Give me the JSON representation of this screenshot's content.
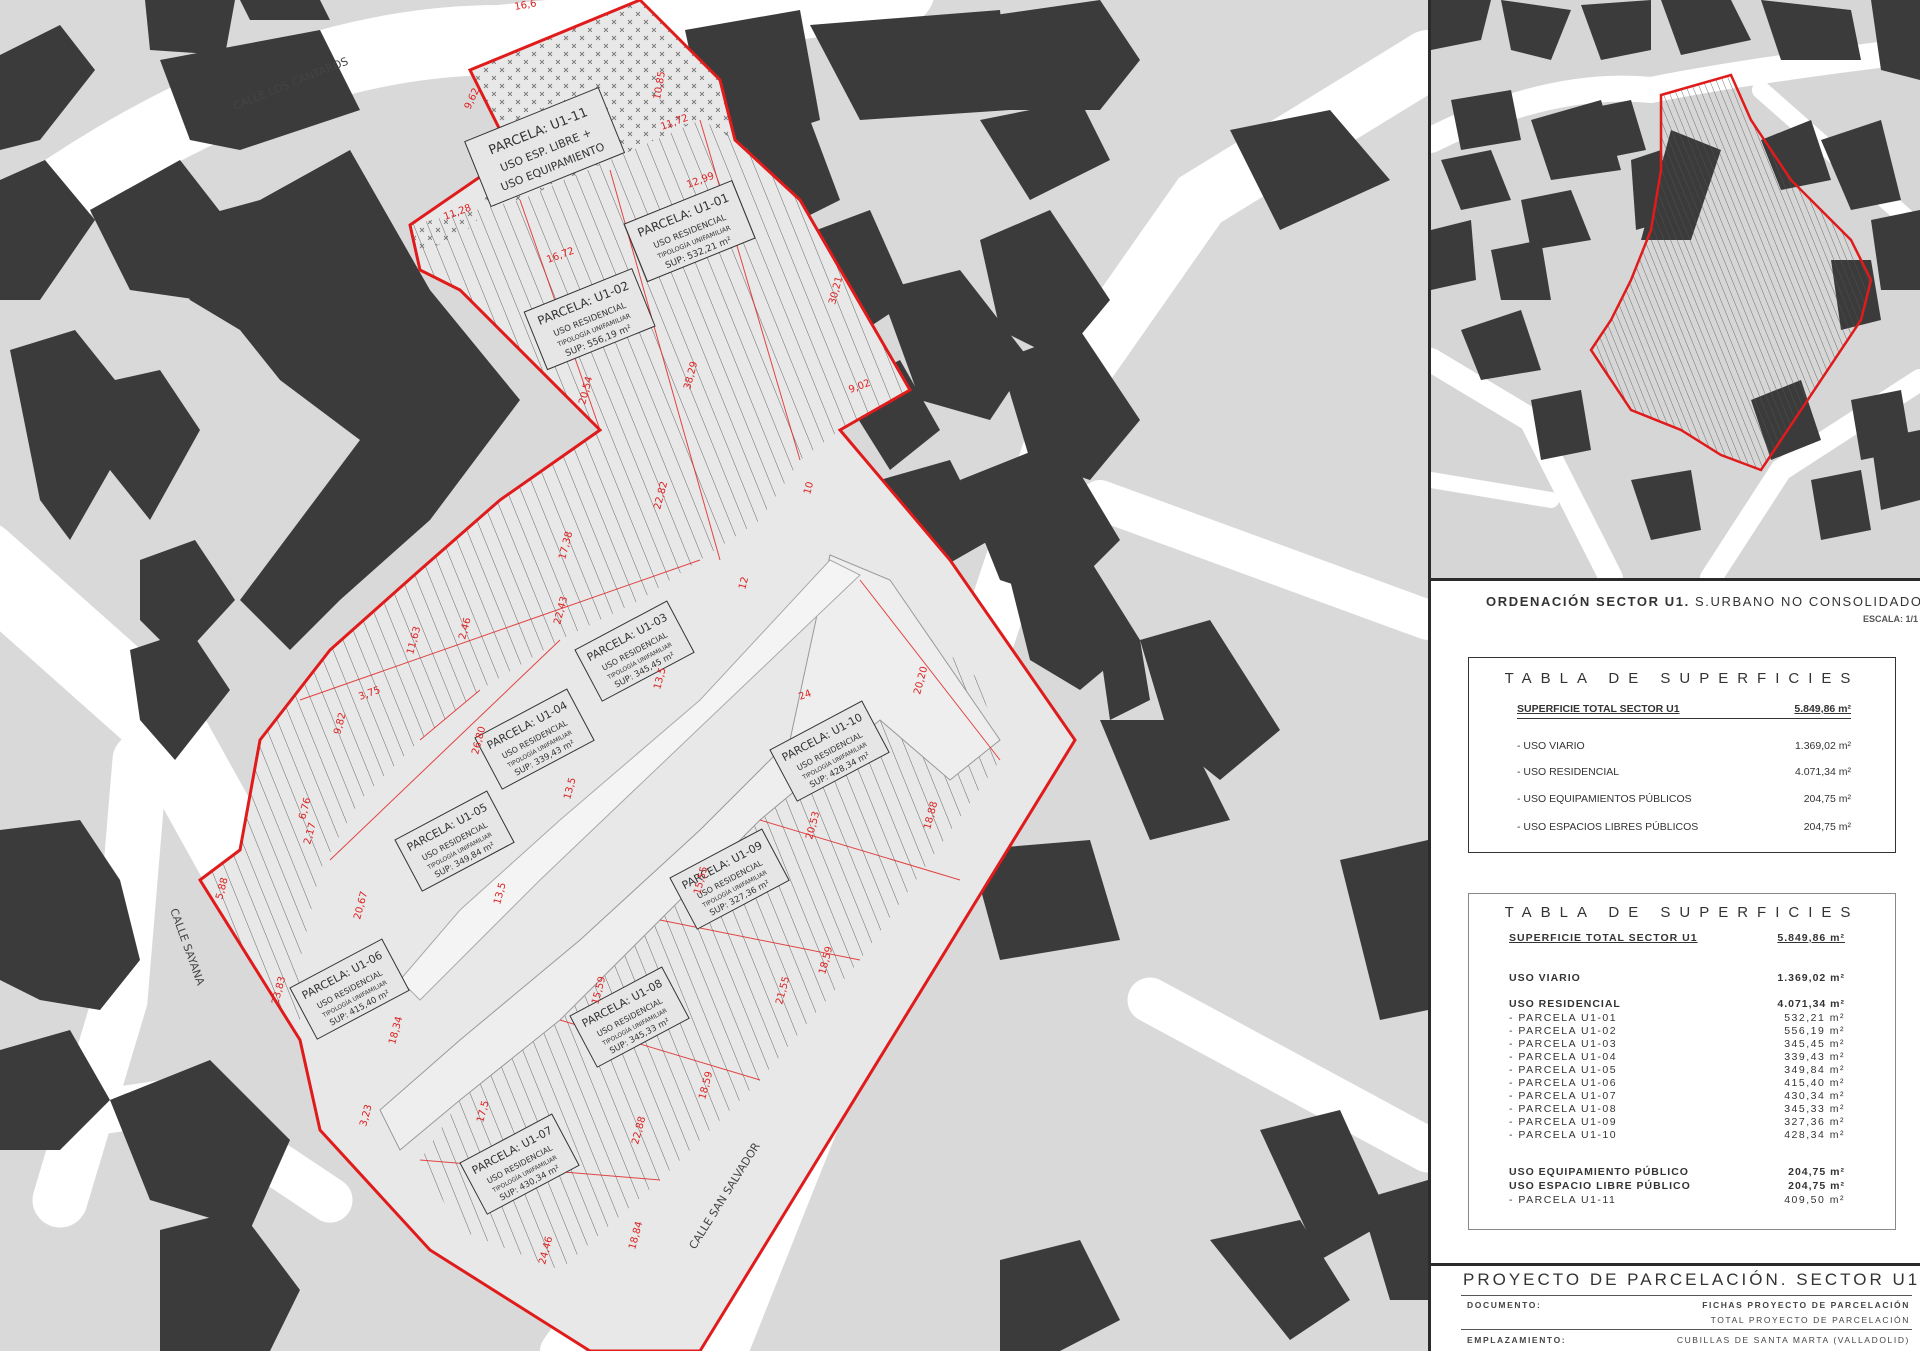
{
  "colors": {
    "building": "#3b3b3b",
    "ground": "#d9d9d9",
    "street": "#ffffff",
    "boundary": "#e01b1b",
    "label_box": "#e6e6e6",
    "road_area": "#ececec"
  },
  "streets": {
    "los_cantaros": "CALLE LOS CANTAROS",
    "sayana": "CALLE SAYANA",
    "san_salvador": "CALLE SAN SALVADOR"
  },
  "parcels": [
    {
      "id": "U1-11",
      "title": "PARCELA: U1-11",
      "line1": "USO ESP. LIBRE +",
      "line2": "USO EQUIPAMIENTO",
      "line3": ""
    },
    {
      "id": "U1-01",
      "title": "PARCELA: U1-01",
      "line1": "USO RESIDENCIAL",
      "line2": "TIPOLOGÍA UNIFAMILIAR",
      "line3": "SUP: 532,21 m²"
    },
    {
      "id": "U1-02",
      "title": "PARCELA: U1-02",
      "line1": "USO RESIDENCIAL",
      "line2": "TIPOLOGÍA UNIFAMILIAR",
      "line3": "SUP: 556,19 m²"
    },
    {
      "id": "U1-03",
      "title": "PARCELA: U1-03",
      "line1": "USO RESIDENCIAL",
      "line2": "TIPOLOGÍA UNIFAMILIAR",
      "line3": "SUP: 345,45 m²"
    },
    {
      "id": "U1-04",
      "title": "PARCELA: U1-04",
      "line1": "USO RESIDENCIAL",
      "line2": "TIPOLOGÍA UNIFAMILIAR",
      "line3": "SUP: 339,43 m²"
    },
    {
      "id": "U1-05",
      "title": "PARCELA: U1-05",
      "line1": "USO RESIDENCIAL",
      "line2": "TIPOLOGÍA UNIFAMILIAR",
      "line3": "SUP: 349,84 m²"
    },
    {
      "id": "U1-06",
      "title": "PARCELA: U1-06",
      "line1": "USO RESIDENCIAL",
      "line2": "TIPOLOGÍA UNIFAMILIAR",
      "line3": "SUP: 415,40 m²"
    },
    {
      "id": "U1-07",
      "title": "PARCELA: U1-07",
      "line1": "USO RESIDENCIAL",
      "line2": "TIPOLOGÍA UNIFAMILIAR",
      "line3": "SUP: 430,34 m²"
    },
    {
      "id": "U1-08",
      "title": "PARCELA: U1-08",
      "line1": "USO RESIDENCIAL",
      "line2": "TIPOLOGÍA UNIFAMILIAR",
      "line3": "SUP: 345,33 m²"
    },
    {
      "id": "U1-09",
      "title": "PARCELA: U1-09",
      "line1": "USO RESIDENCIAL",
      "line2": "TIPOLOGÍA UNIFAMILIAR",
      "line3": "SUP: 327,36 m²"
    },
    {
      "id": "U1-10",
      "title": "PARCELA: U1-10",
      "line1": "USO RESIDENCIAL",
      "line2": "TIPOLOGÍA UNIFAMILIAR",
      "line3": "SUP: 428,34 m²"
    }
  ],
  "dimensions": [
    "16,6",
    "9,62",
    "10,85",
    "11,72",
    "12,99",
    "16,72",
    "11,28",
    "30,21",
    "38,29",
    "20,54",
    "9,02",
    "22,82",
    "10",
    "17,38",
    "12",
    "22,43",
    "13,5",
    "11,63",
    "2,46",
    "3,75",
    "9,82",
    "26,80",
    "13,5",
    "24",
    "20,20",
    "6,76",
    "2,17",
    "5,88",
    "20,67",
    "13,5",
    "15,55",
    "20,53",
    "18,88",
    "23,83",
    "18,34",
    "15,59",
    "21,55",
    "18,59",
    "3,23",
    "17,5",
    "22,88",
    "18,59",
    "24,46",
    "18,84"
  ],
  "ordenacion": {
    "bold": "ORDENACIÓN SECTOR U1.",
    "rest": " S.URBANO NO CONSOLIDADO",
    "escala": "ESCALA: 1/1"
  },
  "table1": {
    "title": "TABLA DE SUPERFICIES",
    "total_label": "SUPERFICIE TOTAL SECTOR U1",
    "total_value": "5.849,86 m²",
    "rows": [
      {
        "label": "-   USO VIARIO",
        "value": "1.369,02 m²"
      },
      {
        "label": "-   USO RESIDENCIAL",
        "value": "4.071,34 m²"
      },
      {
        "label": "-   USO EQUIPAMIENTOS PÚBLICOS",
        "value": "204,75 m²"
      },
      {
        "label": "-   USO ESPACIOS LIBRES PÚBLICOS",
        "value": "204,75 m²"
      }
    ]
  },
  "table2": {
    "title": "TABLA DE SUPERFICIES",
    "total_label": "SUPERFICIE TOTAL SECTOR U1",
    "total_value": "5.849,86 m²",
    "viario": {
      "label": "USO VIARIO",
      "value": "1.369,02 m²"
    },
    "residencial": {
      "label": "USO RESIDENCIAL",
      "value": "4.071,34 m²"
    },
    "parcelas": [
      {
        "label": "-   PARCELA U1-01",
        "value": "532,21 m²"
      },
      {
        "label": "-   PARCELA U1-02",
        "value": "556,19 m²"
      },
      {
        "label": "-   PARCELA U1-03",
        "value": "345,45 m²"
      },
      {
        "label": "-   PARCELA U1-04",
        "value": "339,43 m²"
      },
      {
        "label": "-   PARCELA U1-05",
        "value": "349,84 m²"
      },
      {
        "label": "-   PARCELA U1-06",
        "value": "415,40 m²"
      },
      {
        "label": "-   PARCELA U1-07",
        "value": "430,34 m²"
      },
      {
        "label": "-   PARCELA U1-08",
        "value": "345,33 m²"
      },
      {
        "label": "-   PARCELA U1-09",
        "value": "327,36 m²"
      },
      {
        "label": "-   PARCELA U1-10",
        "value": "428,34 m²"
      }
    ],
    "equipamiento": {
      "label": "USO EQUIPAMIENTO PÚBLICO",
      "value": "204,75 m²"
    },
    "espacio_libre": {
      "label": "USO ESPACIO LIBRE PÚBLICO",
      "value": "204,75 m²"
    },
    "parcela_11": {
      "label": "-   PARCELA U1-11",
      "value": "409,50 m²"
    }
  },
  "project": {
    "title": "PROYECTO DE PARCELACIÓN. SECTOR U1",
    "documento_label": "DOCUMENTO:",
    "documento_value1": "FICHAS PROYECTO DE PARCELACIÓN",
    "documento_value2": "TOTAL PROYECTO DE PARCELACIÓN",
    "emplazamiento_label": "EMPLAZAMIENTO:",
    "emplazamiento_value": "CUBILLAS DE SANTA MARTA (VALLADOLID)"
  }
}
